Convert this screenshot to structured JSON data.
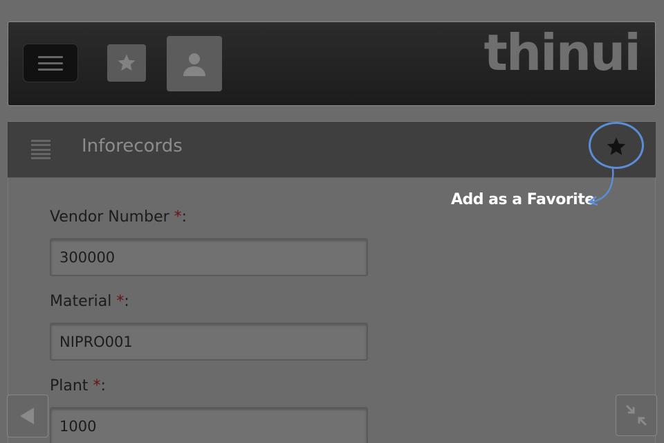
{
  "header": {
    "logo_text": "thinui",
    "menu_icon": "hamburger-icon",
    "favorites_icon": "star-icon",
    "user_icon": "user-icon"
  },
  "section": {
    "title": "Inforecords",
    "list_icon": "list-icon",
    "favorite_icon": "star-icon"
  },
  "annotation": {
    "text": "Add as a Favorite",
    "ring_color": "#5b8ed6"
  },
  "form": {
    "fields": [
      {
        "label": "Vendor Number",
        "required_mark": "*",
        "suffix": ":",
        "value": "300000"
      },
      {
        "label": "Material",
        "required_mark": "*",
        "suffix": ":",
        "value": "NIPRO001"
      },
      {
        "label": "Plant",
        "required_mark": "*",
        "suffix": ":",
        "value": "1000"
      }
    ]
  },
  "controls": {
    "back_icon": "triangle-left-icon",
    "collapse_icon": "collapse-arrows-icon"
  }
}
